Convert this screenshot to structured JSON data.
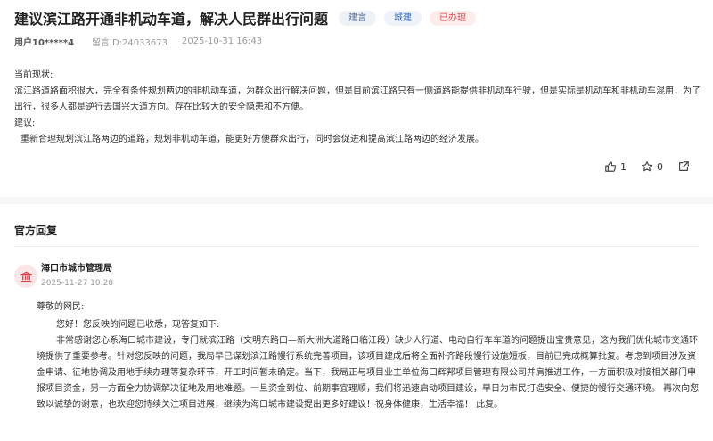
{
  "post": {
    "title": "建议滨江路开通非机动车道，解决人民群出行问题",
    "tags": [
      "建言",
      "城建"
    ],
    "status": "已办理",
    "user": "用户10*****4",
    "message_id": "留言ID:24033673",
    "datetime": "2025-10-31 16:43",
    "current_label": "当前现状:",
    "current_text": "滨江路道路面积很大，完全有条件规划两边的非机动车道，为群众出行解决问题，但是目前滨江路只有一侧道路能提供非机动车行驶，但是实际是机动车和非机动车混用，为了出行，很多人都是逆行去国兴大道方向。存在比较大的安全隐患和不方便。",
    "suggestion_label": "建议:",
    "suggestion_text": "重新合理规划滨江路两边的道路，规划非机动车道，能更好方便群众出行，同时会促进和提高滨江路两边的经济发展。",
    "likes": "1",
    "favorites": "0"
  },
  "official": {
    "section_title": "官方回复",
    "org_name": "海口市城市管理局",
    "reply_time": "2025-11-27 10:28",
    "greeting": "尊敬的网民:",
    "para1": "您好！您反映的问题已收悉，现答复如下:",
    "para2": "非常感谢您心系海口城市建设，专门就滨江路（文明东路口—新大洲大道路口临江段）缺少人行道、电动自行车车道的问题提出宝贵意见，这为我们优化城市交通环境提供了重要参考。针对您反映的问题，我局早已谋划滨江路慢行系统完善项目，该项目建成后将全面补齐路段慢行设施短板，目前已完成概算批复。考虑到项目涉及资金申请、征地协调及用地手续办理等复杂环节，开工时间暂未确定。当下，我局正与项目业主单位海口辉邦项目管理有限公司并肩推进工作，一方面积极对接相关部门申报项目资金，另一方面全力协调解决征地及用地难题。一旦资金到位、前期事宜理顺，我们将迅速启动项目建设，早日为市民打造安全、便捷的慢行交通环境。 再次向您致以诚挚的谢意，也欢迎您持续关注项目进展，继续为海口城市建设提出更多好建议！祝身体健康，生活幸福！ 此复。"
  },
  "colors": {
    "status_red": "#e0474c",
    "tag_blue": "#3b6fc1",
    "divider": "#f5f6f8"
  },
  "icons": [
    "thumbs-up-icon",
    "star-icon",
    "share-icon",
    "building-icon"
  ]
}
